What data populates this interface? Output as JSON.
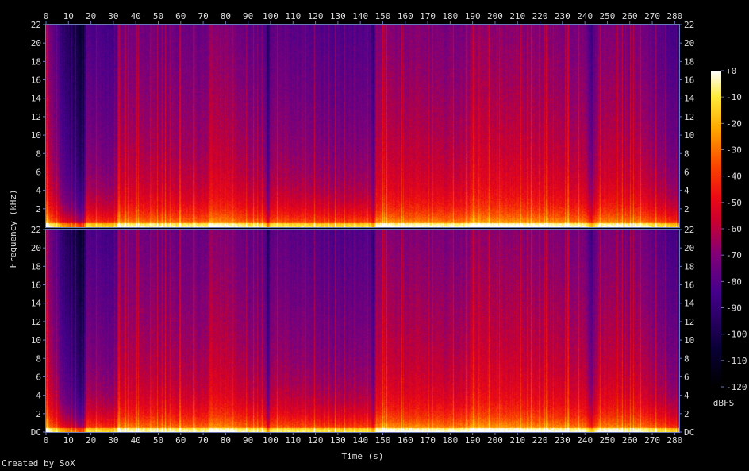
{
  "chart_data": {
    "type": "heatmap",
    "xlabel": "Time (s)",
    "ylabel": "Frequency (kHz)",
    "colorbar_label": "dBFS",
    "credit": "Created by SoX",
    "x_ticks": [
      "0",
      "10",
      "20",
      "30",
      "40",
      "50",
      "60",
      "70",
      "80",
      "90",
      "100",
      "110",
      "120",
      "130",
      "140",
      "150",
      "160",
      "170",
      "180",
      "190",
      "200",
      "210",
      "220",
      "230",
      "240",
      "250",
      "260",
      "270",
      "280"
    ],
    "xlim": [
      0,
      282
    ],
    "y_ticks": [
      "DC",
      "2",
      "4",
      "6",
      "8",
      "10",
      "12",
      "14",
      "16",
      "18",
      "20",
      "22"
    ],
    "ylim_khz": [
      0,
      22
    ],
    "colorbar_ticks": [
      "+0",
      "-10",
      "-20",
      "-30",
      "-40",
      "-50",
      "-60",
      "-70",
      "-80",
      "-90",
      "-100",
      "-110",
      "-120"
    ],
    "zlim_dbfs": [
      -120,
      0
    ],
    "channels": 2,
    "colors": {
      "background": "#000000",
      "text": "#dddddd",
      "axis": "#6a78b8"
    },
    "segments_db": [
      {
        "t": 0,
        "level": -52
      },
      {
        "t": 3,
        "level": -62
      },
      {
        "t": 8,
        "level": -78
      },
      {
        "t": 17,
        "level": -96
      },
      {
        "t": 18,
        "level": -66
      },
      {
        "t": 31,
        "level": -72
      },
      {
        "t": 32,
        "level": -58
      },
      {
        "t": 72,
        "level": -62
      },
      {
        "t": 73,
        "level": -52
      },
      {
        "t": 98,
        "level": -66
      },
      {
        "t": 99,
        "level": -92
      },
      {
        "t": 100,
        "level": -62
      },
      {
        "t": 128,
        "level": -68
      },
      {
        "t": 143,
        "level": -66
      },
      {
        "t": 146,
        "level": -76
      },
      {
        "t": 147,
        "level": -55
      },
      {
        "t": 188,
        "level": -58
      },
      {
        "t": 189,
        "level": -52
      },
      {
        "t": 240,
        "level": -58
      },
      {
        "t": 243,
        "level": -74
      },
      {
        "t": 246,
        "level": -56
      },
      {
        "t": 262,
        "level": -60
      },
      {
        "t": 263,
        "level": -56
      },
      {
        "t": 280,
        "level": -72
      },
      {
        "t": 282,
        "level": -84
      }
    ]
  }
}
